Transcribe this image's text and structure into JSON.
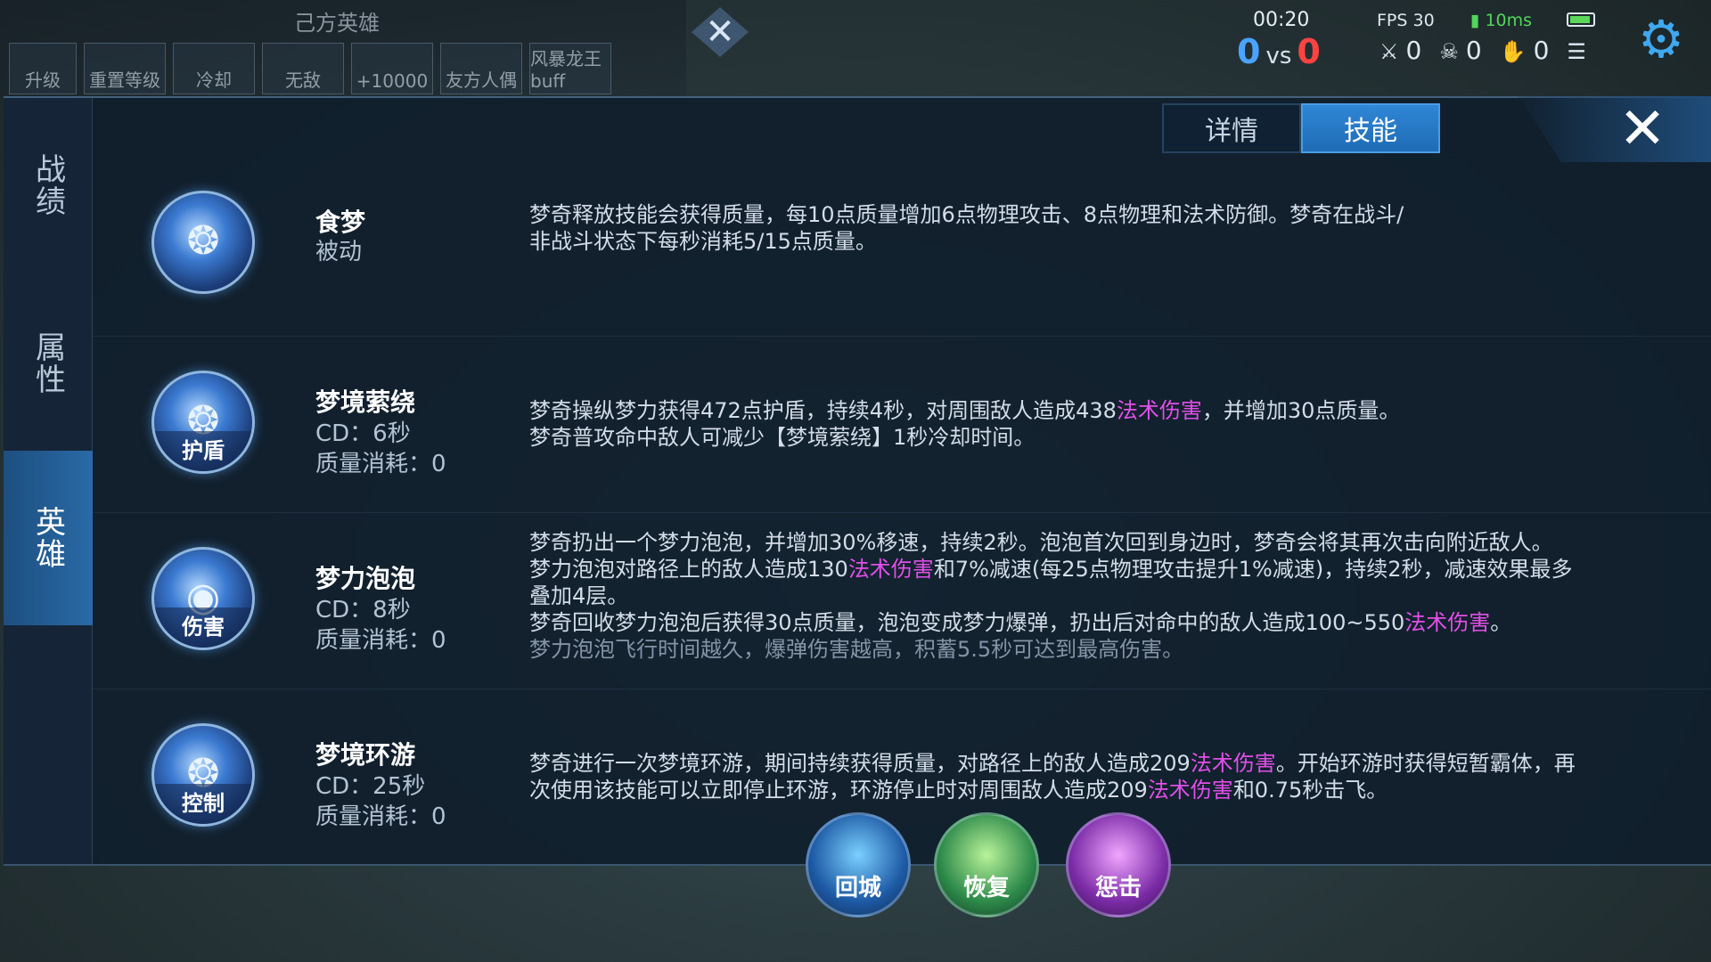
{
  "background": {
    "ally_heroes_label": "己方英雄",
    "buttons": [
      "升级",
      "重置等级",
      "冷却",
      "无敌",
      "+10000",
      "友方人偶",
      "风暴龙王buff"
    ]
  },
  "hud": {
    "time": "00:20",
    "score_blue": "0",
    "vs": "vs",
    "score_red": "0",
    "fps": "FPS 30",
    "ping": "10ms",
    "kills": "0",
    "deaths": "0",
    "assists": "0"
  },
  "sidebar": {
    "tabs": [
      {
        "label": "战绩",
        "active": false
      },
      {
        "label": "属性",
        "active": false
      },
      {
        "label": "英雄",
        "active": true
      }
    ]
  },
  "top_tabs": [
    {
      "label": "详情",
      "active": false
    },
    {
      "label": "技能",
      "active": true
    }
  ],
  "close_label": "✕",
  "skills": [
    {
      "name": "食梦",
      "line1": "被动",
      "line2": "",
      "icon_tag": "",
      "desc_1": "梦奇释放技能会获得质量，每10点质量增加6点物理攻击、8点物理和法术防御。梦奇在战斗/",
      "desc_2": "非战斗状态下每秒消耗5/15点质量。"
    },
    {
      "name": "梦境萦绕",
      "line1": "CD：6秒",
      "line2": "质量消耗：0",
      "icon_tag": "护盾",
      "desc_1a": "梦奇操纵梦力获得472点护盾，持续4秒，对周围敌人造成438",
      "desc_1hl": "法术伤害",
      "desc_1b": "，并增加30点质量。",
      "desc_2": "梦奇普攻命中敌人可减少【梦境萦绕】1秒冷却时间。"
    },
    {
      "name": "梦力泡泡",
      "line1": "CD：8秒",
      "line2": "质量消耗：0",
      "icon_tag": "伤害",
      "desc_1": "梦奇扔出一个梦力泡泡，并增加30%移速，持续2秒。泡泡首次回到身边时，梦奇会将其再次击向附近敌人。",
      "desc_2a": "梦力泡泡对路径上的敌人造成130",
      "desc_2hl": "法术伤害",
      "desc_2b": "和7%减速(每25点物理攻击提升1%减速)，持续2秒，减速效果最多",
      "desc_3": "叠加4层。",
      "desc_4a": "梦奇回收梦力泡泡后获得30点质量，泡泡变成梦力爆弹，扔出后对命中的敌人造成100~550",
      "desc_4hl": "法术伤害",
      "desc_4b": "。",
      "desc_5": "梦力泡泡飞行时间越久，爆弹伤害越高，积蓄5.5秒可达到最高伤害。"
    },
    {
      "name": "梦境环游",
      "line1": "CD：25秒",
      "line2": "质量消耗：0",
      "icon_tag": "控制",
      "desc_1a": "梦奇进行一次梦境环游，期间持续获得质量，对路径上的敌人造成209",
      "desc_1hl": "法术伤害",
      "desc_1b": "。开始环游时获得短暂霸体，再",
      "desc_2a": "次使用该技能可以立即停止环游，环游停止时对周围敌人造成209",
      "desc_2hl": "法术伤害",
      "desc_2b": "和0.75秒击飞。"
    }
  ],
  "bottom_buttons": [
    "回城",
    "恢复",
    "惩击"
  ],
  "colors": {
    "highlight": "#e14fe8",
    "accent_blue": "#2f87d6",
    "score_blue": "#4aa3ff",
    "score_red": "#ff4242"
  }
}
